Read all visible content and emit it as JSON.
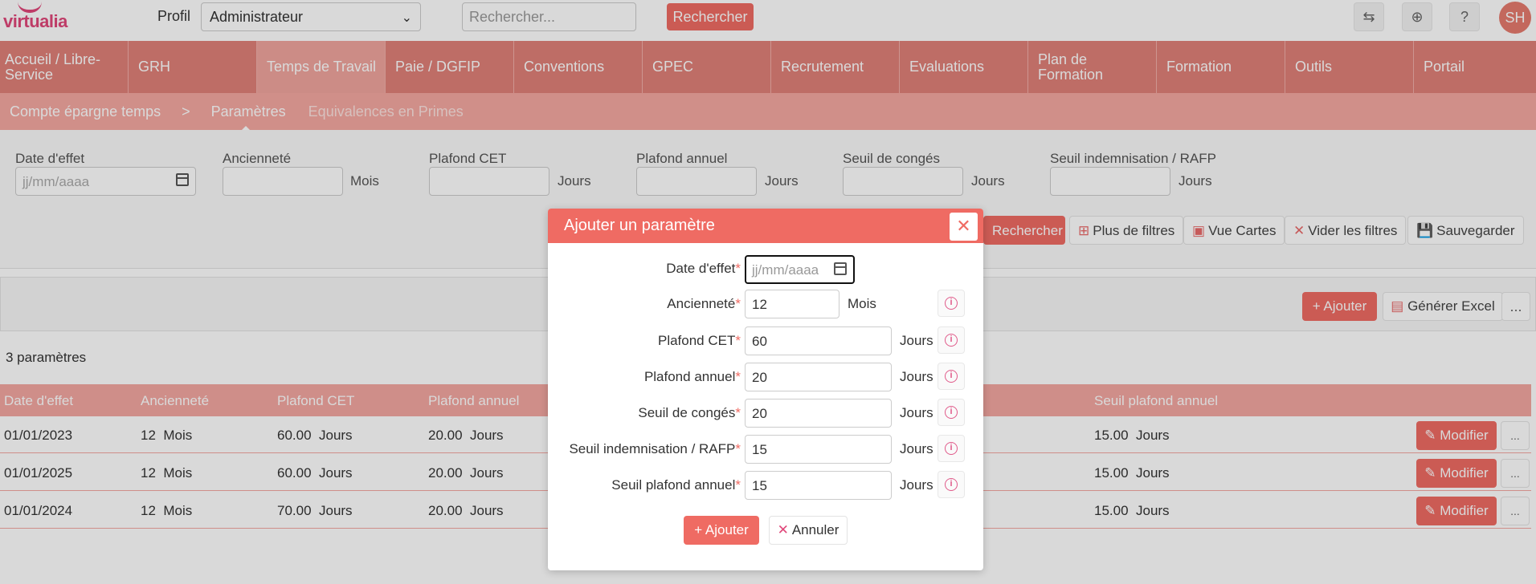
{
  "brand": {
    "logo_text": "virtualia"
  },
  "topbar": {
    "profil_label": "Profil",
    "profil_value": "Administrateur",
    "search_placeholder": "Rechercher...",
    "search_button": "Rechercher",
    "icons": [
      "refresh-icon",
      "plus-circle-icon",
      "help-icon"
    ],
    "avatar_initials": "SH"
  },
  "main_nav": [
    {
      "label": "Accueil / Libre-Service",
      "active": false
    },
    {
      "label": "GRH",
      "active": false
    },
    {
      "label": "Temps de Travail",
      "active": true
    },
    {
      "label": "Paie / DGFIP",
      "active": false
    },
    {
      "label": "Conventions",
      "active": false
    },
    {
      "label": "GPEC",
      "active": false
    },
    {
      "label": "Recrutement",
      "active": false
    },
    {
      "label": "Evaluations",
      "active": false
    },
    {
      "label": "Plan de Formation",
      "active": false
    },
    {
      "label": "Formation",
      "active": false
    },
    {
      "label": "Outils",
      "active": false
    },
    {
      "label": "Portail",
      "active": false
    }
  ],
  "sub_nav": {
    "crumb": "Compte épargne temps",
    "separator": ">",
    "active": "Paramètres",
    "other": "Equivalences en Primes"
  },
  "filters": {
    "date_label": "Date d'effet",
    "date_placeholder": "jj/mm/aaaa",
    "anciennete_label": "Ancienneté",
    "anciennete_unit": "Mois",
    "plafond_cet_label": "Plafond CET",
    "plafond_cet_unit": "Jours",
    "plafond_annuel_label": "Plafond annuel",
    "plafond_annuel_unit": "Jours",
    "seuil_conges_label": "Seuil de congés",
    "seuil_conges_unit": "Jours",
    "seuil_indem_label": "Seuil indemnisation / RAFP",
    "seuil_indem_unit": "Jours",
    "btn_search": "Rechercher",
    "btn_more_filters": "Plus de filtres",
    "btn_cards": "Vue Cartes",
    "btn_clear": "Vider les filtres",
    "btn_save": "Sauvegarder"
  },
  "toolbar": {
    "add_label": "Ajouter",
    "excel_label": "Générer Excel",
    "more_label": "..."
  },
  "results_count": "3 paramètres",
  "table": {
    "headers": [
      "Date d'effet",
      "Ancienneté",
      "Plafond CET",
      "Plafond annuel",
      "Seuil plafond annuel"
    ],
    "rows": [
      {
        "date": "01/01/2023",
        "anciennete": "12  Mois",
        "plafond_cet": "60.00  Jours",
        "plafond_annuel": "20.00  Jours",
        "seuil_plafond": "15.00  Jours"
      },
      {
        "date": "01/01/2025",
        "anciennete": "12  Mois",
        "plafond_cet": "60.00  Jours",
        "plafond_annuel": "20.00  Jours",
        "seuil_plafond": "15.00  Jours"
      },
      {
        "date": "01/01/2024",
        "anciennete": "12  Mois",
        "plafond_cet": "70.00  Jours",
        "plafond_annuel": "20.00  Jours",
        "seuil_plafond": "15.00  Jours"
      }
    ],
    "modify_label": "Modifier",
    "row_more": "..."
  },
  "modal": {
    "title": "Ajouter un paramètre",
    "fields": [
      {
        "label": "Date d'effet",
        "value": "",
        "placeholder": "jj/mm/aaaa",
        "unit": "",
        "required": true
      },
      {
        "label": "Ancienneté",
        "value": "12",
        "unit": "Mois",
        "required": true
      },
      {
        "label": "Plafond CET",
        "value": "60",
        "unit": "Jours",
        "required": true
      },
      {
        "label": "Plafond annuel",
        "value": "20",
        "unit": "Jours",
        "required": true
      },
      {
        "label": "Seuil de congés",
        "value": "20",
        "unit": "Jours",
        "required": true
      },
      {
        "label": "Seuil indemnisation / RAFP",
        "value": "15",
        "unit": "Jours",
        "required": true
      },
      {
        "label": "Seuil plafond annuel",
        "value": "15",
        "unit": "Jours",
        "required": true
      }
    ],
    "required_mark": "*",
    "add_button": "Ajouter",
    "cancel_button": "Annuler"
  },
  "colors": {
    "accent": "#ef6b63",
    "nav_bg": "#e08078",
    "subnav_bg": "#f5a8a1",
    "brand_pink": "#e0477a"
  }
}
